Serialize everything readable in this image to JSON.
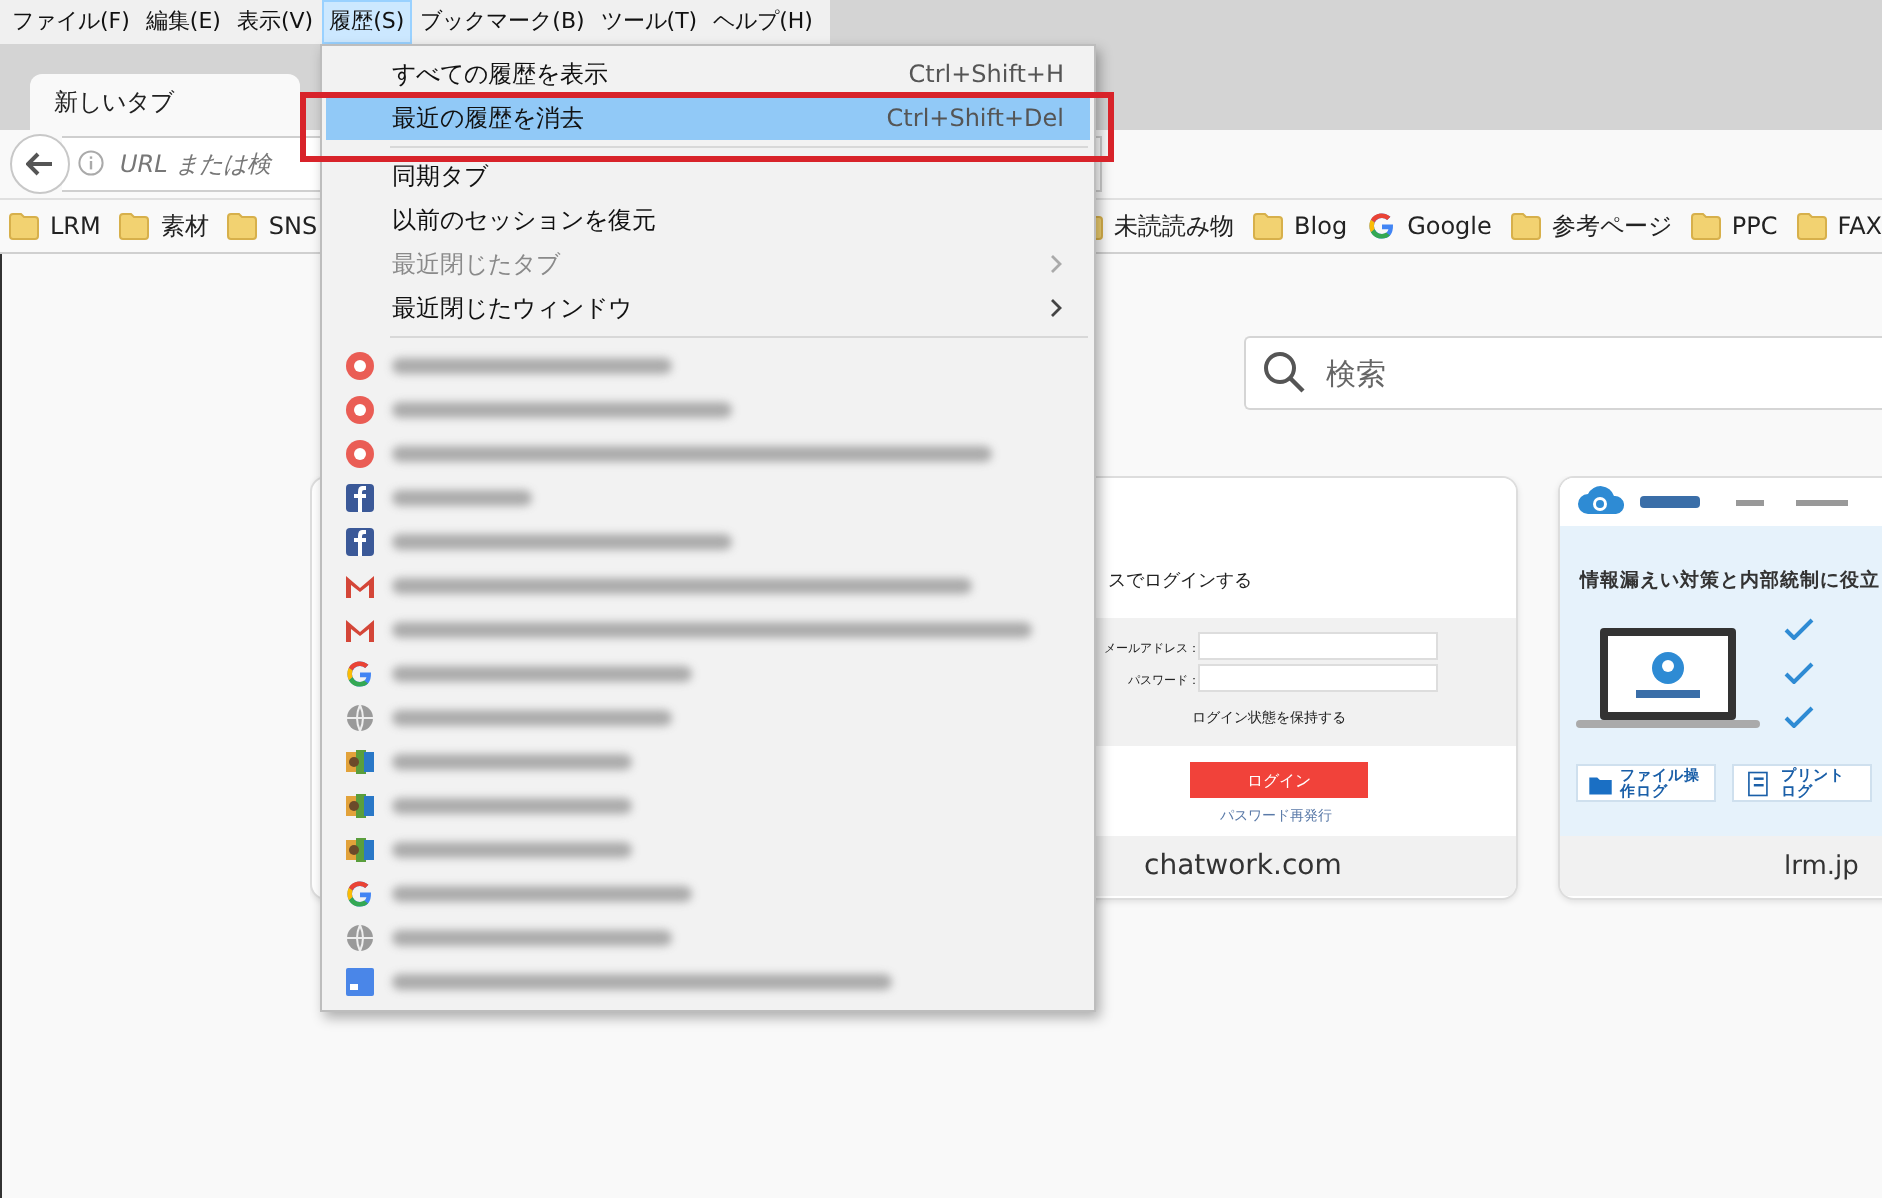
{
  "menu_bar": [
    {
      "label": "ファイル(F)",
      "selected": false
    },
    {
      "label": "編集(E)",
      "selected": false
    },
    {
      "label": "表示(V)",
      "selected": false
    },
    {
      "label": "履歴(S)",
      "selected": true
    },
    {
      "label": "ブックマーク(B)",
      "selected": false
    },
    {
      "label": "ツール(T)",
      "selected": false
    },
    {
      "label": "ヘルプ(H)",
      "selected": false
    }
  ],
  "tabs": [
    {
      "label": "新しいタブ",
      "selected": true
    }
  ],
  "url_bar": {
    "placeholder": "URL または検"
  },
  "bookmarks_left": [
    {
      "kind": "folder",
      "label": "LRM"
    },
    {
      "kind": "folder",
      "label": "素材"
    },
    {
      "kind": "folder",
      "label": "SNS"
    }
  ],
  "bookmarks_right": [
    {
      "kind": "folder",
      "label": "未読読み物"
    },
    {
      "kind": "folder",
      "label": "Blog"
    },
    {
      "kind": "google",
      "label": "Google"
    },
    {
      "kind": "folder",
      "label": "参考ページ"
    },
    {
      "kind": "folder",
      "label": "PPC"
    },
    {
      "kind": "folder",
      "label": "FAX"
    }
  ],
  "search": {
    "placeholder": "検索"
  },
  "tiles": [
    {
      "kind": "blank"
    },
    {
      "kind": "login",
      "caption": "chatwork.com",
      "heading": "スでログインする",
      "email_label": "メールアドレス：",
      "password_label": "パスワード：",
      "remember": "ログイン状態を保持する",
      "button": "ログイン",
      "link": "パスワード再発行"
    },
    {
      "kind": "product",
      "caption": "lrm.jp",
      "heading": "情報漏えい対策と内部統制に役立",
      "buttons": [
        "ファイル操作ログ",
        "プリントログ"
      ]
    }
  ],
  "history_menu": {
    "items": [
      {
        "label": "すべての履歴を表示",
        "shortcut": "Ctrl+Shift+H",
        "selected": false,
        "disabled": false,
        "outlined": false
      },
      {
        "label": "最近の履歴を消去",
        "shortcut": "Ctrl+Shift+Del",
        "selected": true,
        "disabled": false,
        "outlined": true
      },
      {
        "kind": "separator"
      },
      {
        "label": "同期タブ",
        "selected": false,
        "disabled": false,
        "outlined": false
      },
      {
        "label": "以前のセッションを復元",
        "selected": false,
        "disabled": false,
        "outlined": false
      },
      {
        "label": "最近閉じたタブ",
        "submenu": true,
        "selected": false,
        "disabled": true,
        "outlined": false
      },
      {
        "label": "最近閉じたウィンドウ",
        "submenu": true,
        "selected": false,
        "disabled": false,
        "outlined": false
      },
      {
        "kind": "separator"
      }
    ],
    "recent_pages": [
      {
        "kind": "chat"
      },
      {
        "kind": "chat"
      },
      {
        "kind": "chat"
      },
      {
        "kind": "facebook"
      },
      {
        "kind": "facebook"
      },
      {
        "kind": "mail"
      },
      {
        "kind": "mail"
      },
      {
        "kind": "google"
      },
      {
        "kind": "globe"
      },
      {
        "kind": "zoho"
      },
      {
        "kind": "zoho"
      },
      {
        "kind": "zoho"
      },
      {
        "kind": "google"
      },
      {
        "kind": "globe"
      },
      {
        "kind": "calendar"
      }
    ]
  }
}
